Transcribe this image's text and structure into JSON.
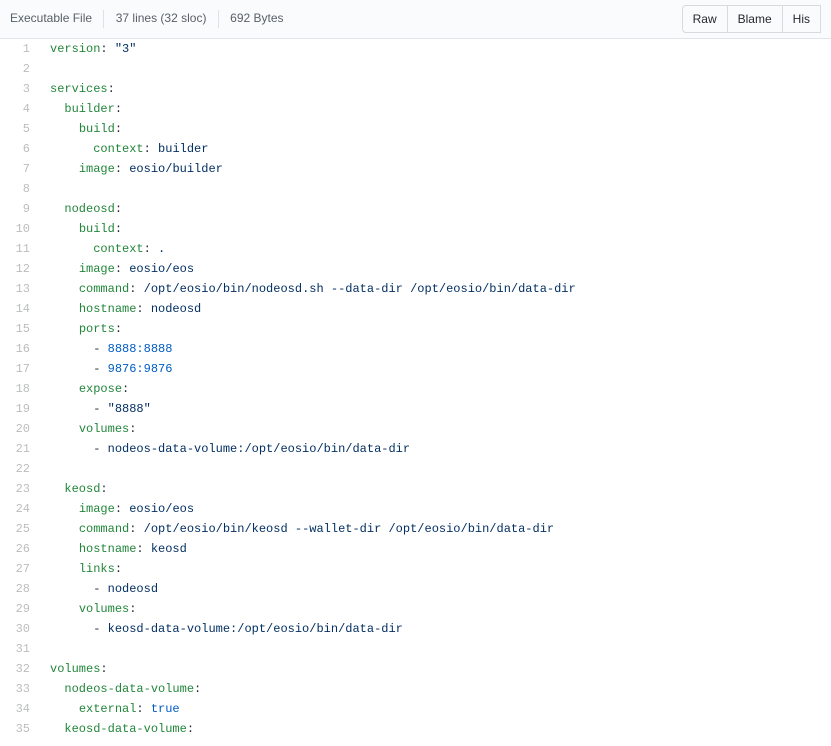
{
  "header": {
    "file_mode": "Executable File",
    "lines_info": "37 lines (32 sloc)",
    "size": "692 Bytes",
    "buttons": {
      "raw": "Raw",
      "blame": "Blame",
      "history": "His"
    }
  },
  "code": {
    "lines": [
      {
        "n": 1,
        "indent": 0,
        "segments": [
          [
            "key",
            "version"
          ],
          [
            "pun",
            ": "
          ],
          [
            "str",
            "\"3\""
          ]
        ]
      },
      {
        "n": 2,
        "indent": 0,
        "segments": []
      },
      {
        "n": 3,
        "indent": 0,
        "segments": [
          [
            "key",
            "services"
          ],
          [
            "pun",
            ":"
          ]
        ]
      },
      {
        "n": 4,
        "indent": 1,
        "segments": [
          [
            "key",
            "builder"
          ],
          [
            "pun",
            ":"
          ]
        ]
      },
      {
        "n": 5,
        "indent": 2,
        "segments": [
          [
            "key",
            "build"
          ],
          [
            "pun",
            ":"
          ]
        ]
      },
      {
        "n": 6,
        "indent": 3,
        "segments": [
          [
            "key",
            "context"
          ],
          [
            "pun",
            ": "
          ],
          [
            "str",
            "builder"
          ]
        ]
      },
      {
        "n": 7,
        "indent": 2,
        "segments": [
          [
            "key",
            "image"
          ],
          [
            "pun",
            ": "
          ],
          [
            "str",
            "eosio/builder"
          ]
        ]
      },
      {
        "n": 8,
        "indent": 0,
        "segments": []
      },
      {
        "n": 9,
        "indent": 1,
        "segments": [
          [
            "key",
            "nodeosd"
          ],
          [
            "pun",
            ":"
          ]
        ]
      },
      {
        "n": 10,
        "indent": 2,
        "segments": [
          [
            "key",
            "build"
          ],
          [
            "pun",
            ":"
          ]
        ]
      },
      {
        "n": 11,
        "indent": 3,
        "segments": [
          [
            "key",
            "context"
          ],
          [
            "pun",
            ": "
          ],
          [
            "str",
            "."
          ]
        ]
      },
      {
        "n": 12,
        "indent": 2,
        "segments": [
          [
            "key",
            "image"
          ],
          [
            "pun",
            ": "
          ],
          [
            "str",
            "eosio/eos"
          ]
        ]
      },
      {
        "n": 13,
        "indent": 2,
        "segments": [
          [
            "key",
            "command"
          ],
          [
            "pun",
            ": "
          ],
          [
            "str",
            "/opt/eosio/bin/nodeosd.sh --data-dir /opt/eosio/bin/data-dir"
          ]
        ]
      },
      {
        "n": 14,
        "indent": 2,
        "segments": [
          [
            "key",
            "hostname"
          ],
          [
            "pun",
            ": "
          ],
          [
            "str",
            "nodeosd"
          ]
        ]
      },
      {
        "n": 15,
        "indent": 2,
        "segments": [
          [
            "key",
            "ports"
          ],
          [
            "pun",
            ":"
          ]
        ]
      },
      {
        "n": 16,
        "indent": 3,
        "segments": [
          [
            "dash",
            "- "
          ],
          [
            "num",
            "8888:8888"
          ]
        ]
      },
      {
        "n": 17,
        "indent": 3,
        "segments": [
          [
            "dash",
            "- "
          ],
          [
            "num",
            "9876:9876"
          ]
        ]
      },
      {
        "n": 18,
        "indent": 2,
        "segments": [
          [
            "key",
            "expose"
          ],
          [
            "pun",
            ":"
          ]
        ]
      },
      {
        "n": 19,
        "indent": 3,
        "segments": [
          [
            "dash",
            "- "
          ],
          [
            "str",
            "\"8888\""
          ]
        ]
      },
      {
        "n": 20,
        "indent": 2,
        "segments": [
          [
            "key",
            "volumes"
          ],
          [
            "pun",
            ":"
          ]
        ]
      },
      {
        "n": 21,
        "indent": 3,
        "segments": [
          [
            "dash",
            "- "
          ],
          [
            "str",
            "nodeos-data-volume:/opt/eosio/bin/data-dir"
          ]
        ]
      },
      {
        "n": 22,
        "indent": 0,
        "segments": []
      },
      {
        "n": 23,
        "indent": 1,
        "segments": [
          [
            "key",
            "keosd"
          ],
          [
            "pun",
            ":"
          ]
        ]
      },
      {
        "n": 24,
        "indent": 2,
        "segments": [
          [
            "key",
            "image"
          ],
          [
            "pun",
            ": "
          ],
          [
            "str",
            "eosio/eos"
          ]
        ]
      },
      {
        "n": 25,
        "indent": 2,
        "segments": [
          [
            "key",
            "command"
          ],
          [
            "pun",
            ": "
          ],
          [
            "str",
            "/opt/eosio/bin/keosd --wallet-dir /opt/eosio/bin/data-dir"
          ]
        ]
      },
      {
        "n": 26,
        "indent": 2,
        "segments": [
          [
            "key",
            "hostname"
          ],
          [
            "pun",
            ": "
          ],
          [
            "str",
            "keosd"
          ]
        ]
      },
      {
        "n": 27,
        "indent": 2,
        "segments": [
          [
            "key",
            "links"
          ],
          [
            "pun",
            ":"
          ]
        ]
      },
      {
        "n": 28,
        "indent": 3,
        "segments": [
          [
            "dash",
            "- "
          ],
          [
            "str",
            "nodeosd"
          ]
        ]
      },
      {
        "n": 29,
        "indent": 2,
        "segments": [
          [
            "key",
            "volumes"
          ],
          [
            "pun",
            ":"
          ]
        ]
      },
      {
        "n": 30,
        "indent": 3,
        "segments": [
          [
            "dash",
            "- "
          ],
          [
            "str",
            "keosd-data-volume:/opt/eosio/bin/data-dir"
          ]
        ]
      },
      {
        "n": 31,
        "indent": 0,
        "segments": []
      },
      {
        "n": 32,
        "indent": 0,
        "segments": [
          [
            "key",
            "volumes"
          ],
          [
            "pun",
            ":"
          ]
        ]
      },
      {
        "n": 33,
        "indent": 1,
        "segments": [
          [
            "key",
            "nodeos-data-volume"
          ],
          [
            "pun",
            ":"
          ]
        ]
      },
      {
        "n": 34,
        "indent": 2,
        "segments": [
          [
            "key",
            "external"
          ],
          [
            "pun",
            ": "
          ],
          [
            "bool",
            "true"
          ]
        ]
      },
      {
        "n": 35,
        "indent": 1,
        "segments": [
          [
            "key",
            "keosd-data-volume"
          ],
          [
            "pun",
            ":"
          ]
        ]
      }
    ]
  }
}
